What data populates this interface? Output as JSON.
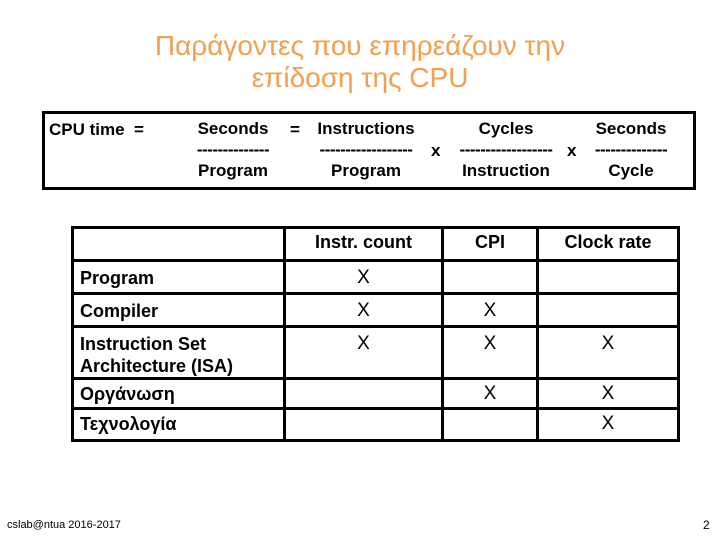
{
  "slide": {
    "title_line1": "Παράγοντες που επηρεάζουν την",
    "title_line2": "επίδοση της CPU",
    "title_color": "#F0A04E"
  },
  "formula": {
    "lhs": "CPU time",
    "equals": "=",
    "term1": {
      "numerator": "Seconds",
      "divider": "--------------",
      "denominator": "Program"
    },
    "equals2": "=",
    "term2": {
      "numerator": "Instructions",
      "divider": "------------------",
      "denominator": "Program"
    },
    "times1": "x",
    "term3": {
      "numerator": "Cycles",
      "divider": "------------------",
      "denominator": "Instruction"
    },
    "times2": "x",
    "term4": {
      "numerator": "Seconds",
      "divider": "--------------",
      "denominator": "Cycle"
    }
  },
  "table": {
    "headers": [
      "",
      "Instr. count",
      "CPI",
      "Clock rate"
    ],
    "rows": [
      {
        "label": "Program",
        "cells": [
          "X",
          "",
          ""
        ]
      },
      {
        "label": "Compiler",
        "cells": [
          "X",
          "X",
          ""
        ]
      },
      {
        "label_line1": "Instruction Set",
        "label_line2": "Architecture (ISA)",
        "cells": [
          "X",
          "X",
          "X"
        ]
      },
      {
        "label": "Οργάνωση",
        "cells": [
          "",
          "X",
          "X"
        ]
      },
      {
        "label": "Τεχνολογία",
        "cells": [
          "",
          "",
          "X"
        ]
      }
    ]
  },
  "footer": {
    "left": "cslab@ntua 2016-2017",
    "page_number": "2"
  }
}
